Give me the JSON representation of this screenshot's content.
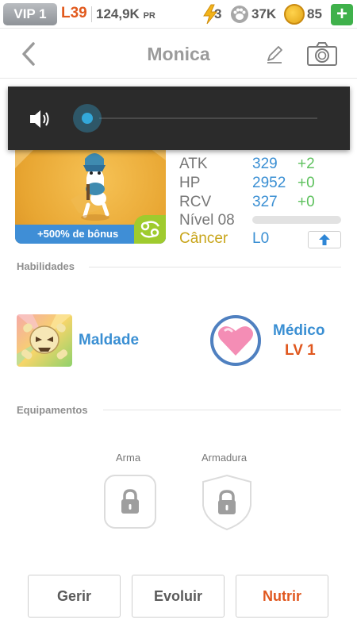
{
  "status": {
    "vip": "VIP 1",
    "level": "L39",
    "pr_value": "124,9K",
    "pr_unit": "PR",
    "energy": "3",
    "paws": "37K",
    "coins": "85",
    "plus": "+"
  },
  "header": {
    "title": "Monica"
  },
  "pet": {
    "bonus": "+500% de bônus",
    "stats": [
      {
        "label": "ATK",
        "value": "329",
        "bonus": "+2"
      },
      {
        "label": "HP",
        "value": "2952",
        "bonus": "+0"
      },
      {
        "label": "RCV",
        "value": "327",
        "bonus": "+0"
      }
    ],
    "level_label": "Nível 08",
    "sign": "Câncer",
    "rank": "L0"
  },
  "skills": {
    "title": "Habilidades",
    "items": [
      {
        "name": "Maldade",
        "icon": "skull-icon"
      },
      {
        "name": "Médico",
        "level": "LV 1",
        "icon": "heart-icon"
      }
    ]
  },
  "equipment": {
    "title": "Equipamentos",
    "weapon": "Arma",
    "armor": "Armadura"
  },
  "actions": {
    "manage": "Gerir",
    "evolve": "Evoluir",
    "feed": "Nutrir"
  },
  "volume": {
    "level": 0
  },
  "colors": {
    "accent_blue": "#3a8fd3",
    "orange": "#e0581f",
    "green": "#5ec15e"
  }
}
